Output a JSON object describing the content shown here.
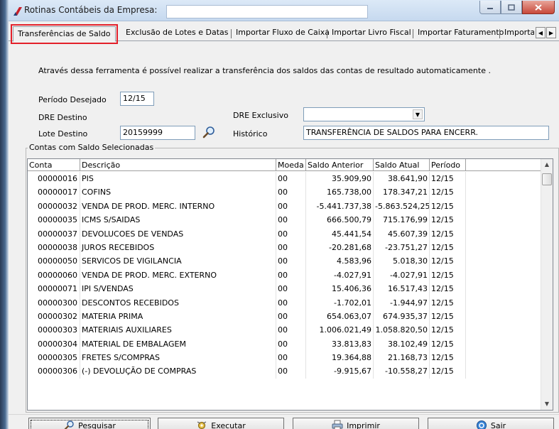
{
  "window": {
    "title": "Rotinas Contábeis da Empresa:"
  },
  "tabs": [
    {
      "label": "Transferências de Saldo",
      "active": true
    },
    {
      "label": "Exclusão de Lotes e Datas",
      "active": false
    },
    {
      "label": "Importar Fluxo de Caixa",
      "active": false
    },
    {
      "label": "Importar Livro Fiscal",
      "active": false
    },
    {
      "label": "Importar Faturamento",
      "active": false
    },
    {
      "label": "Importar",
      "active": false
    }
  ],
  "form": {
    "info": "Através dessa ferramenta é possível realizar a transferência dos saldos das contas de resultado automaticamente .",
    "periodo_label": "Período Desejado",
    "periodo_value": "12/15",
    "dre_destino_label": "DRE Destino",
    "dre_exclusivo_label": "DRE Exclusivo",
    "dre_exclusivo_value": "",
    "lote_destino_label": "Lote Destino",
    "lote_destino_value": "20159999",
    "historico_label": "Histórico",
    "historico_value": "TRANSFERÊNCIA DE SALDOS PARA ENCERR."
  },
  "grid": {
    "group_title": "Contas com Saldo Selecionadas",
    "columns": [
      "Conta",
      "Descrição",
      "Moeda",
      "Saldo Anterior",
      "Saldo Atual",
      "Período"
    ],
    "rows": [
      [
        "00000016",
        "PIS",
        "00",
        "35.909,90",
        "38.641,90",
        "12/15"
      ],
      [
        "00000017",
        "COFINS",
        "00",
        "165.738,00",
        "178.347,21",
        "12/15"
      ],
      [
        "00000032",
        "VENDA DE PROD. MERC. INTERNO",
        "00",
        "-5.441.737,38",
        "-5.863.524,25",
        "12/15"
      ],
      [
        "00000035",
        "ICMS S/SAIDAS",
        "00",
        "666.500,79",
        "715.176,99",
        "12/15"
      ],
      [
        "00000037",
        "DEVOLUCOES DE VENDAS",
        "00",
        "45.441,54",
        "45.607,39",
        "12/15"
      ],
      [
        "00000038",
        "JUROS RECEBIDOS",
        "00",
        "-20.281,68",
        "-23.751,27",
        "12/15"
      ],
      [
        "00000050",
        "SERVICOS DE VIGILANCIA",
        "00",
        "4.583,96",
        "5.018,30",
        "12/15"
      ],
      [
        "00000060",
        "VENDA DE PROD. MERC.  EXTERNO",
        "00",
        "-4.027,91",
        "-4.027,91",
        "12/15"
      ],
      [
        "00000071",
        "IPI S/VENDAS",
        "00",
        "15.406,36",
        "16.517,43",
        "12/15"
      ],
      [
        "00000300",
        "DESCONTOS RECEBIDOS",
        "00",
        "-1.702,01",
        "-1.944,97",
        "12/15"
      ],
      [
        "00000302",
        "MATERIA PRIMA",
        "00",
        "654.063,07",
        "674.935,37",
        "12/15"
      ],
      [
        "00000303",
        "MATERIAIS AUXILIARES",
        "00",
        "1.006.021,49",
        "1.058.820,50",
        "12/15"
      ],
      [
        "00000304",
        "MATERIAL DE EMBALAGEM",
        "00",
        "33.813,83",
        "38.102,49",
        "12/15"
      ],
      [
        "00000305",
        "FRETES S/COMPRAS",
        "00",
        "19.364,88",
        "21.168,73",
        "12/15"
      ],
      [
        "00000306",
        "(-) DEVOLUÇÃO DE COMPRAS",
        "00",
        "-9.915,67",
        "-10.558,27",
        "12/15"
      ]
    ]
  },
  "buttons": {
    "pesquisar": "Pesquisar",
    "executar": "Executar",
    "imprimir": "Imprimir",
    "sair": "Sair"
  },
  "icons": {
    "app": "app-logo-icon",
    "search": "magnifier-icon",
    "executar": "gear-run-icon",
    "imprimir": "printer-icon",
    "sair": "exit-icon"
  }
}
